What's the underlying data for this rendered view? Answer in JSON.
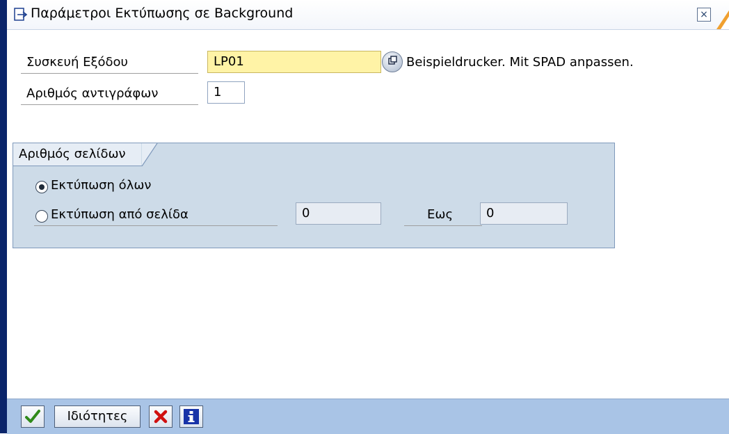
{
  "window": {
    "title": "Παράμετροι Εκτύπωσης σε Background",
    "close_symbol": "×"
  },
  "form": {
    "output_device": {
      "label": "Συσκευή Εξόδου",
      "value": "LP01",
      "description": "Beispieldrucker. Mit SPAD anpassen."
    },
    "copies": {
      "label": "Αριθμός αντιγράφων",
      "value": "1"
    }
  },
  "pages_group": {
    "title": "Αριθμός σελίδων",
    "print_all_label": "Εκτύπωση όλων",
    "print_all_selected": true,
    "print_from_label": "Εκτύπωση από σελίδα",
    "print_from_selected": false,
    "from_value": "0",
    "to_label": "Εως",
    "to_value": "0"
  },
  "toolbar": {
    "confirm_icon": "check-icon",
    "properties_label": "Ιδιότητες",
    "cancel_icon": "cancel-icon",
    "info_icon": "info-icon"
  },
  "colors": {
    "accent": "#0a246a",
    "required_field": "#fff3a6",
    "group_background": "#cddbe8",
    "footer_background": "#a9c4e6",
    "confirm_green": "#2f8a1a",
    "cancel_red": "#d01010",
    "info_blue": "#1833a8"
  }
}
